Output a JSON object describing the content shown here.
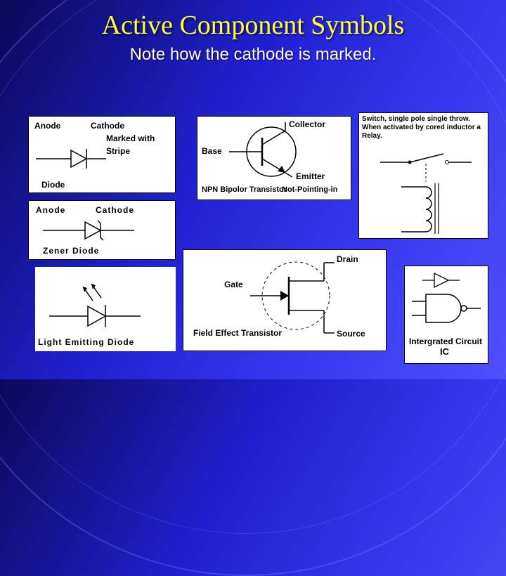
{
  "title": "Active Component Symbols",
  "subtitle": "Note how the cathode is marked.",
  "diode": {
    "anode": "Anode",
    "cathode": "Cathode",
    "marked": "Marked with",
    "stripe": "Stripe",
    "name": "Diode"
  },
  "zener": {
    "anode": "Anode",
    "cathode": "Cathode",
    "name": "Zener Diode"
  },
  "led": {
    "name": "Light Emitting Diode"
  },
  "npn": {
    "collector": "Collector",
    "base": "Base",
    "emitter": "Emitter",
    "name": "NPN Bipolor Transistor",
    "note": "Not-Pointing-in"
  },
  "relay": {
    "desc": "Switch, single pole single throw. When activated by cored inductor a Relay."
  },
  "fet": {
    "drain": "Drain",
    "gate": "Gate",
    "source": "Source",
    "name": "Field Effect Transistor"
  },
  "ic": {
    "name": "Intergrated Circuit",
    "abbrev": "IC"
  }
}
